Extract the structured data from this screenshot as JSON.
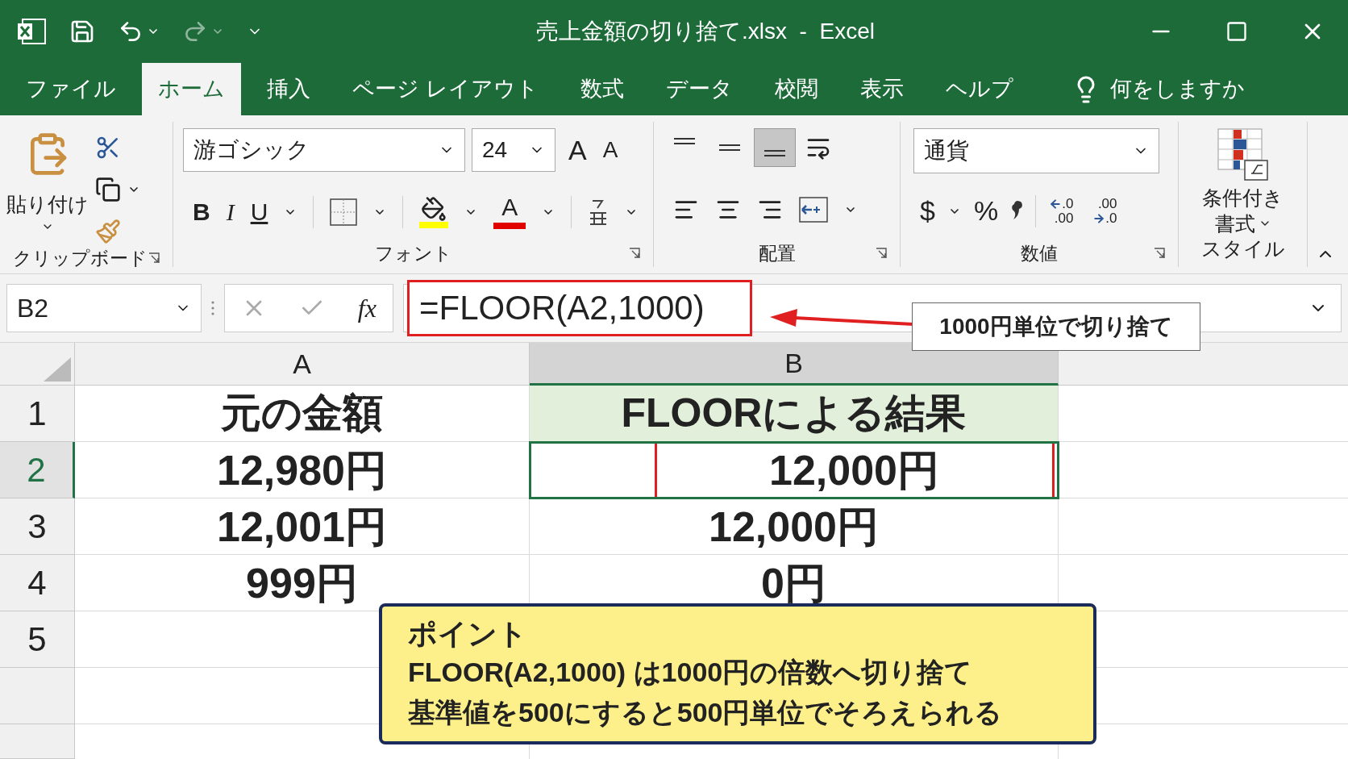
{
  "window": {
    "title": "売上金額の切り捨て.xlsx  -  Excel"
  },
  "tabs": [
    {
      "label": "ファイル",
      "selected": false
    },
    {
      "label": "ホーム",
      "selected": true
    },
    {
      "label": "挿入",
      "selected": false
    },
    {
      "label": "ページ レイアウト",
      "selected": false
    },
    {
      "label": "数式",
      "selected": false
    },
    {
      "label": "データ",
      "selected": false
    },
    {
      "label": "校閲",
      "selected": false
    },
    {
      "label": "表示",
      "selected": false
    },
    {
      "label": "ヘルプ",
      "selected": false
    }
  ],
  "tell_me": {
    "placeholder": "何をしますか"
  },
  "ribbon": {
    "clipboard": {
      "paste": "貼り付け",
      "label": "クリップボード"
    },
    "font": {
      "name": "游ゴシック",
      "size": "24",
      "grow": "A",
      "shrink": "A",
      "bold": "B",
      "italic": "I",
      "underline": "U",
      "font_color": "A",
      "label": "フォント"
    },
    "alignment": {
      "label": "配置",
      "buttons": [
        {
          "kind": "top",
          "selected": false
        },
        {
          "kind": "middle",
          "selected": false
        },
        {
          "kind": "bottom",
          "selected": true
        }
      ]
    },
    "number": {
      "format": "通貨",
      "currency": "$",
      "percent": "%",
      "increase_decimal": [
        ".0",
        ".00"
      ],
      "decrease_decimal": [
        ".00",
        ".0"
      ],
      "label": "数値"
    },
    "styles": {
      "conditional": "条件付き",
      "conditional_2": "書式",
      "label": "スタイル"
    }
  },
  "formula_bar": {
    "name_box": "B2",
    "fx": "fx",
    "formula": "=FLOOR(A2,1000)"
  },
  "callout": "1000円単位で切り捨て",
  "columns": [
    {
      "label": "A",
      "selected": false
    },
    {
      "label": "B",
      "selected": true
    }
  ],
  "rows": [
    {
      "header": "1",
      "selected": false,
      "cells": [
        {
          "text": "元の金額",
          "header": true,
          "selected": false
        },
        {
          "text": "FLOORによる結果",
          "header": true,
          "selected": false
        }
      ]
    },
    {
      "header": "2",
      "selected": true,
      "cells": [
        {
          "text": "12,980円",
          "header": false,
          "selected": false
        },
        {
          "text": "12,000円",
          "header": false,
          "selected": true
        }
      ]
    },
    {
      "header": "3",
      "selected": false,
      "cells": [
        {
          "text": "12,001円",
          "header": false,
          "selected": false
        },
        {
          "text": "12,000円",
          "header": false,
          "selected": false
        }
      ]
    },
    {
      "header": "4",
      "selected": false,
      "cells": [
        {
          "text": "999円",
          "header": false,
          "selected": false
        },
        {
          "text": "0円",
          "header": false,
          "selected": false
        }
      ]
    },
    {
      "header": "5",
      "selected": false,
      "cells": []
    }
  ],
  "note": {
    "title": "ポイント",
    "lines": [
      "FLOOR(A2,1000) は1000円の倍数へ切り捨て",
      "基準値を500にすると500円単位でそろえられる"
    ]
  }
}
